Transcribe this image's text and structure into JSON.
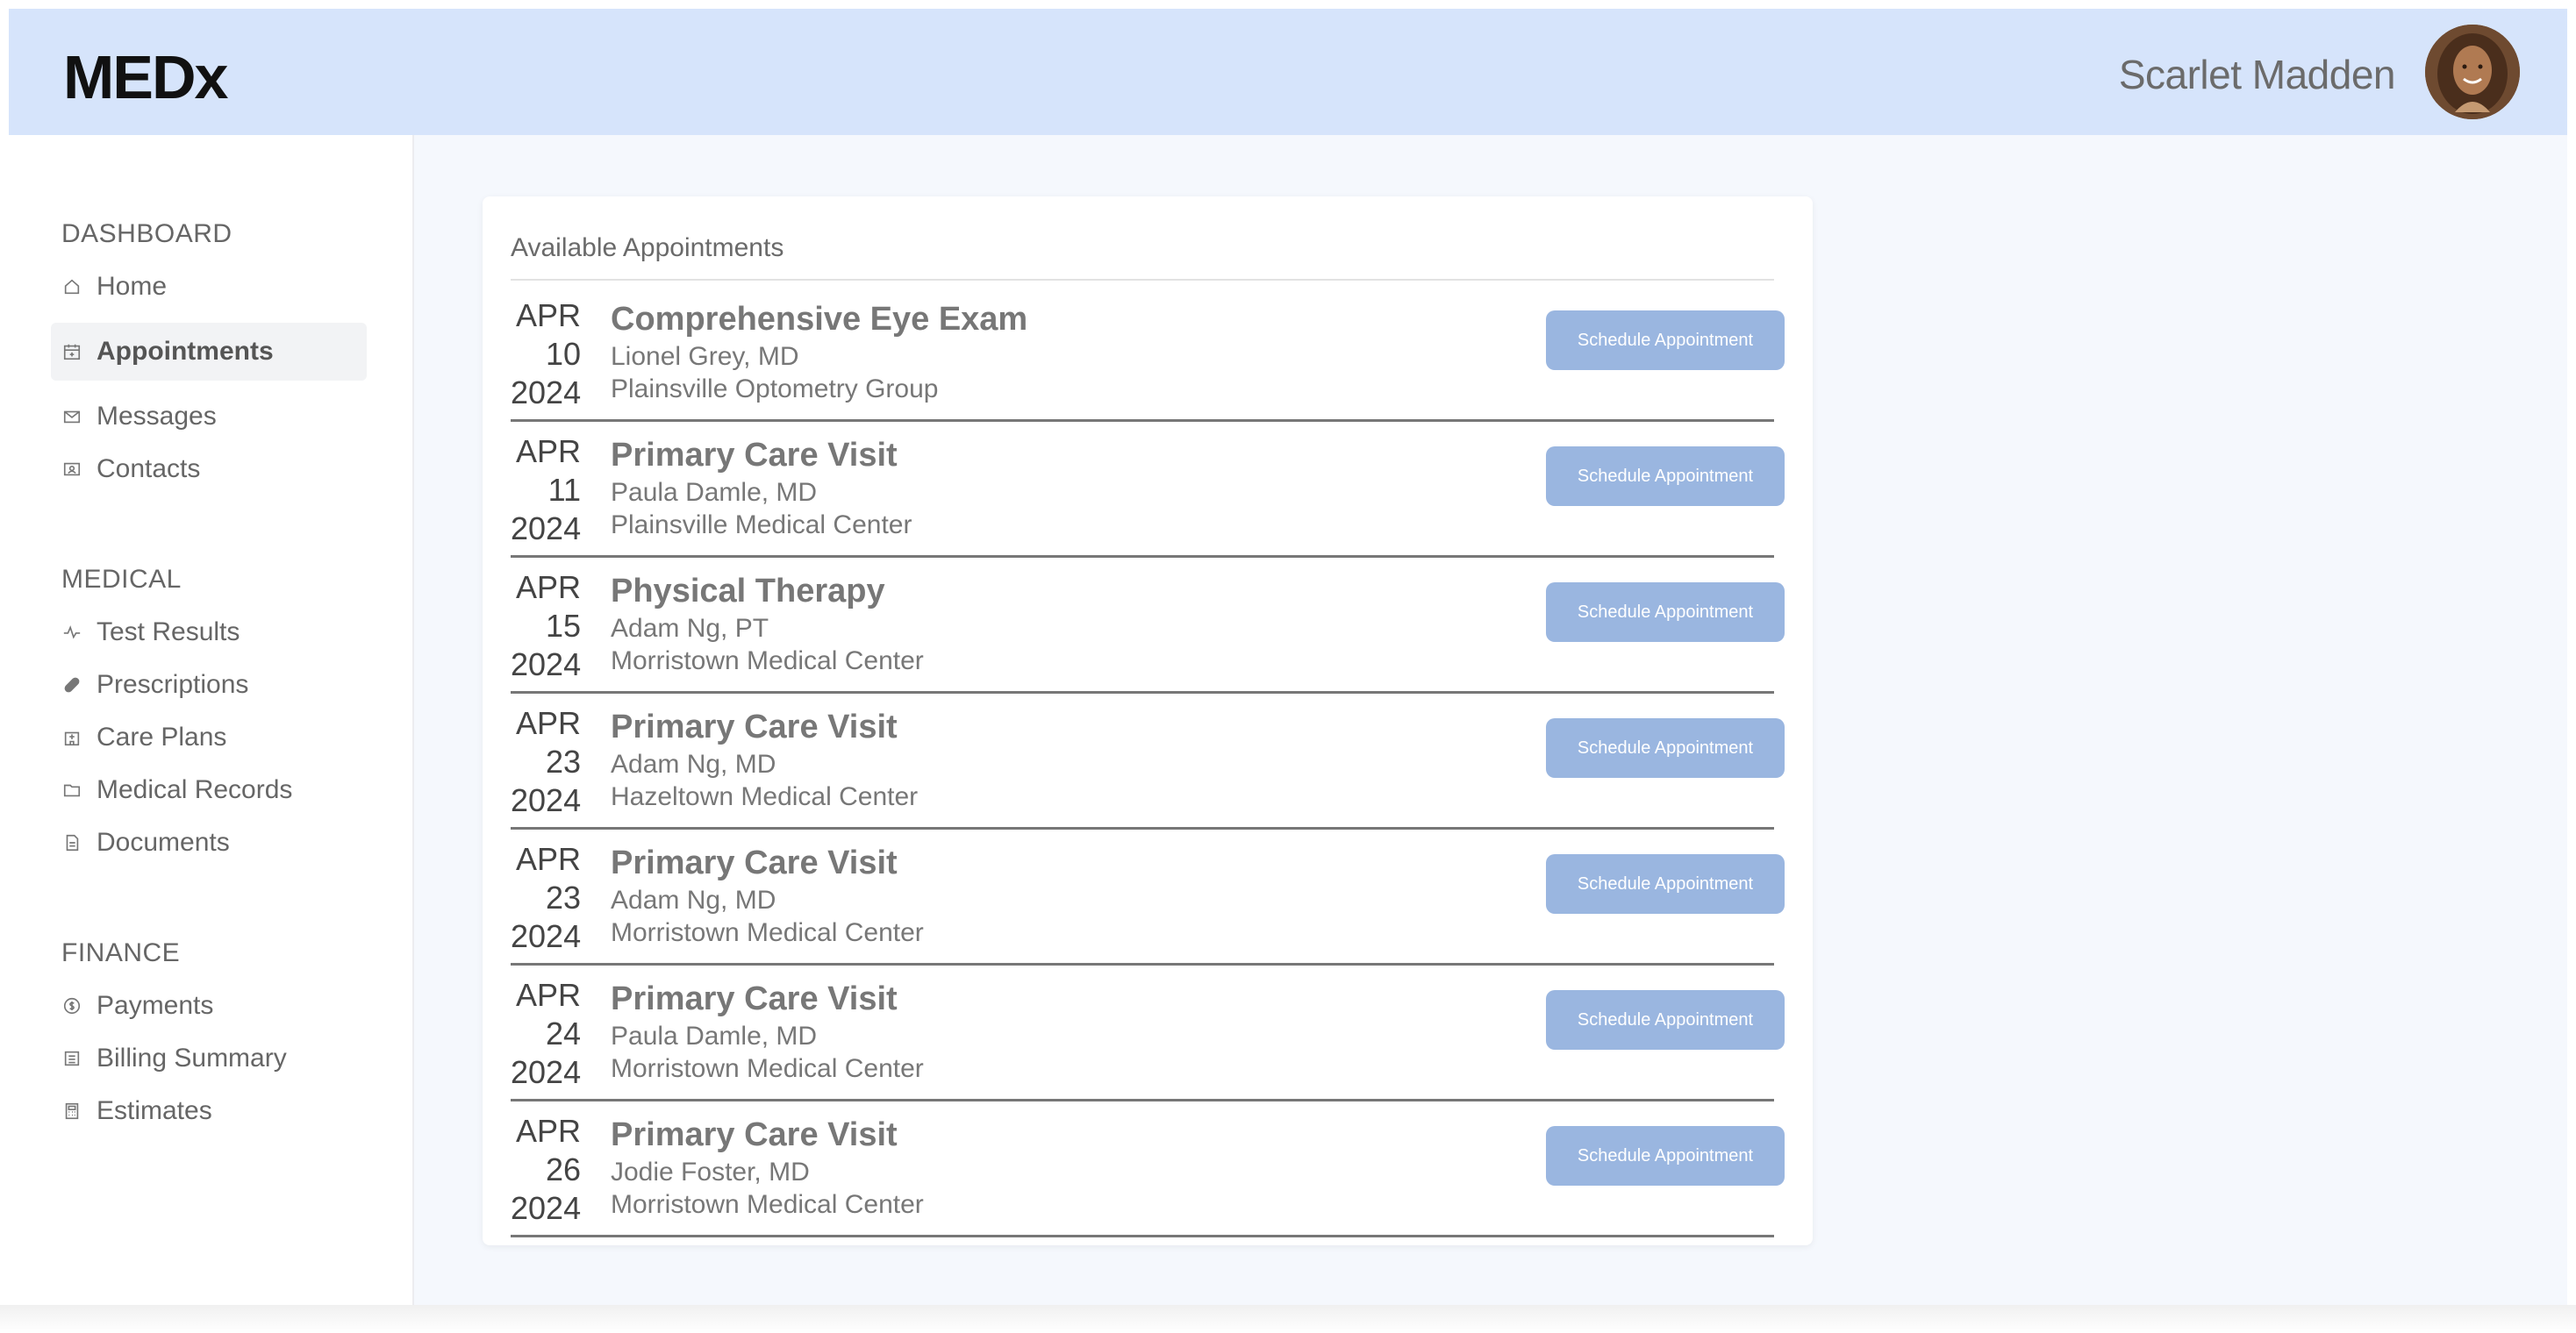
{
  "header": {
    "logo": "MEDx",
    "user_name": "Scarlet Madden"
  },
  "sidebar": {
    "sections": [
      {
        "title": "DASHBOARD",
        "items": [
          {
            "label": "Home",
            "icon": "home-icon"
          },
          {
            "label": "Appointments",
            "icon": "calendar-icon",
            "active": true
          },
          {
            "label": "Messages",
            "icon": "envelope-icon"
          },
          {
            "label": "Contacts",
            "icon": "contact-card-icon"
          }
        ]
      },
      {
        "title": "MEDICAL",
        "items": [
          {
            "label": "Test Results",
            "icon": "pulse-icon"
          },
          {
            "label": "Prescriptions",
            "icon": "pill-icon"
          },
          {
            "label": "Care Plans",
            "icon": "hospital-icon"
          },
          {
            "label": "Medical Records",
            "icon": "folder-icon"
          },
          {
            "label": "Documents",
            "icon": "document-icon"
          }
        ]
      },
      {
        "title": "FINANCE",
        "items": [
          {
            "label": "Payments",
            "icon": "dollar-coin-icon"
          },
          {
            "label": "Billing Summary",
            "icon": "ledger-icon"
          },
          {
            "label": "Estimates",
            "icon": "calculator-icon"
          }
        ]
      }
    ]
  },
  "main": {
    "card_title": "Available Appointments",
    "button_label": "Schedule Appointment",
    "appointments": [
      {
        "month": "APR",
        "day": "10",
        "year": "2024",
        "title": "Comprehensive Eye Exam",
        "doctor": "Lionel Grey, MD",
        "location": "Plainsville Optometry Group"
      },
      {
        "month": "APR",
        "day": "11",
        "year": "2024",
        "title": "Primary Care Visit",
        "doctor": "Paula Damle, MD",
        "location": "Plainsville Medical Center"
      },
      {
        "month": "APR",
        "day": "15",
        "year": "2024",
        "title": "Physical Therapy",
        "doctor": "Adam Ng, PT",
        "location": "Morristown Medical Center"
      },
      {
        "month": "APR",
        "day": "23",
        "year": "2024",
        "title": "Primary Care Visit",
        "doctor": "Adam Ng, MD",
        "location": "Hazeltown Medical Center"
      },
      {
        "month": "APR",
        "day": "23",
        "year": "2024",
        "title": "Primary Care Visit",
        "doctor": "Adam Ng, MD",
        "location": "Morristown Medical Center"
      },
      {
        "month": "APR",
        "day": "24",
        "year": "2024",
        "title": "Primary Care Visit",
        "doctor": "Paula Damle, MD",
        "location": "Morristown Medical Center"
      },
      {
        "month": "APR",
        "day": "26",
        "year": "2024",
        "title": "Primary Care Visit",
        "doctor": "Jodie Foster, MD",
        "location": "Morristown Medical Center"
      }
    ]
  },
  "colors": {
    "header_bg": "#d6e4fb",
    "button_bg": "#9ab6e0",
    "page_bg": "#f5f8fd"
  }
}
